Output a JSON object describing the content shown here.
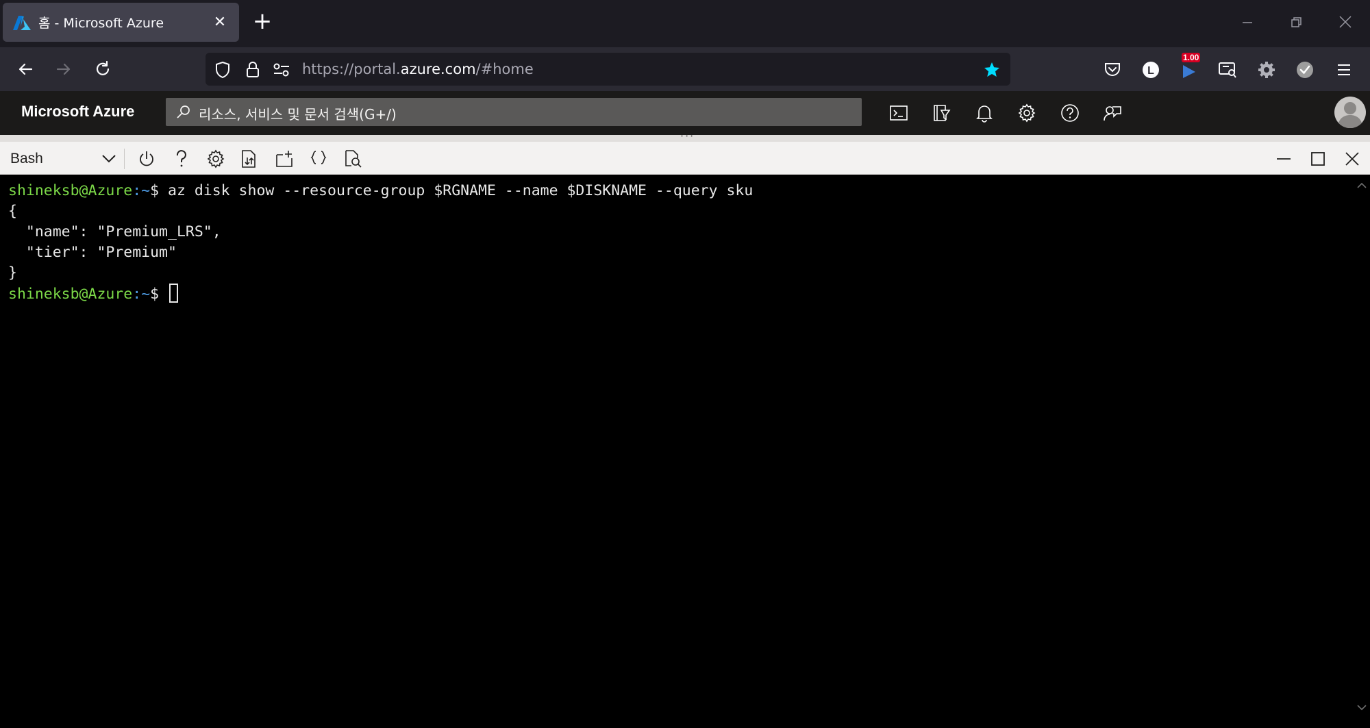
{
  "browser": {
    "tab_title": "홈 - Microsoft Azure",
    "tab_close": "✕",
    "new_tab": "+",
    "url_prefix": "https://portal.",
    "url_host": "azure.com",
    "url_suffix": "/#home",
    "badge": "1.00",
    "accent_color": "#00ddff"
  },
  "azure": {
    "brand": "Microsoft Azure",
    "search_placeholder": "리소스, 서비스 및 문서 검색(G+/)"
  },
  "shell": {
    "type": "Bash",
    "grip": "···"
  },
  "terminal": {
    "lines": [
      {
        "user": "shineksb@Azure",
        "path": ":~",
        "prompt": "$ ",
        "cmd": "az disk show --resource-group $RGNAME --name $DISKNAME --query sku"
      },
      {
        "text": "{"
      },
      {
        "text": "  \"name\": \"Premium_LRS\","
      },
      {
        "text": "  \"tier\": \"Premium\""
      },
      {
        "text": "}"
      },
      {
        "user": "shineksb@Azure",
        "path": ":~",
        "prompt": "$ ",
        "cmd": ""
      }
    ],
    "user_color": "#7cd948",
    "path_color": "#4f9de6"
  }
}
